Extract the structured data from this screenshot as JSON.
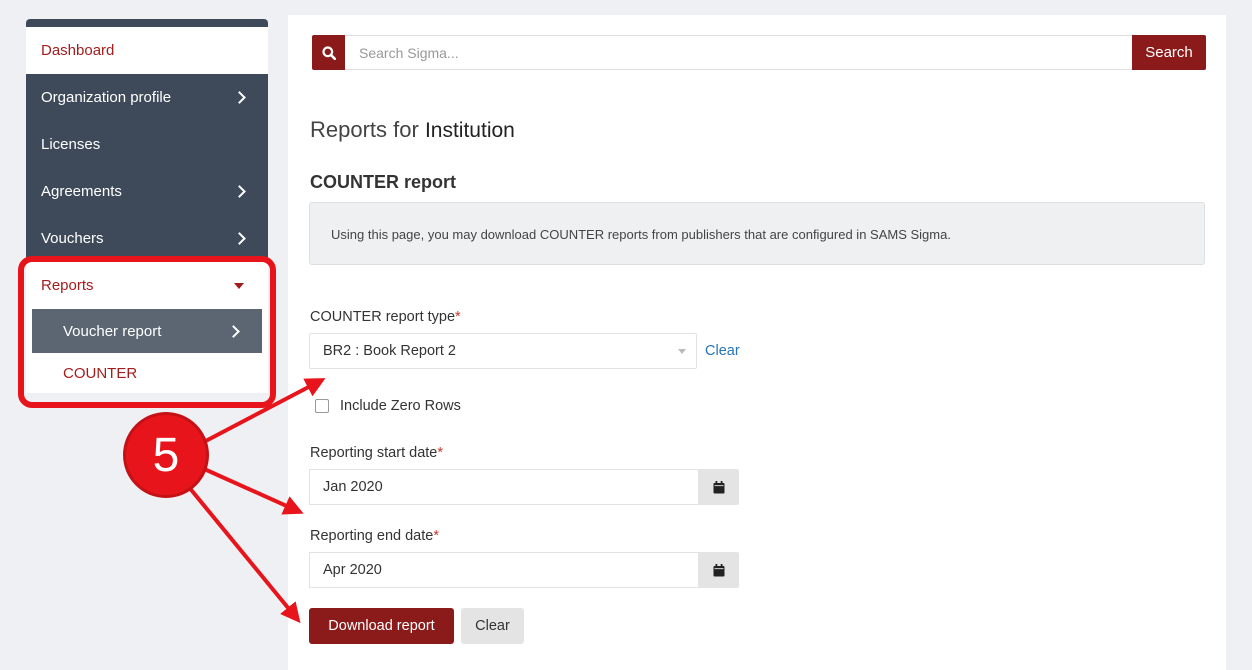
{
  "sidebar": {
    "items": [
      {
        "label": "Dashboard"
      },
      {
        "label": "Organization profile"
      },
      {
        "label": "Licenses"
      },
      {
        "label": "Agreements"
      },
      {
        "label": "Vouchers"
      },
      {
        "label": "Reports"
      },
      {
        "label": "Voucher report"
      },
      {
        "label": "COUNTER"
      }
    ]
  },
  "search": {
    "placeholder": "Search Sigma...",
    "button_label": "Search"
  },
  "main": {
    "title_prefix": "Reports for",
    "title_entity": "Institution",
    "section_title": "COUNTER report",
    "info_text": "Using this page, you may download COUNTER reports from publishers that are configured in SAMS Sigma.",
    "report_type_label": "COUNTER report type",
    "report_type_value": "BR2 : Book Report 2",
    "clear_link": "Clear",
    "include_zero_rows": "Include Zero Rows",
    "start_date_label": "Reporting start date",
    "start_date_value": "Jan 2020",
    "end_date_label": "Reporting end date",
    "end_date_value": "Apr 2020",
    "download_button": "Download report",
    "clear_button": "Clear",
    "required_mark": "*"
  },
  "annotation": {
    "step_number": "5"
  },
  "colors": {
    "brand": "#8b1a1a",
    "sidebar_dark": "#3e4a5a",
    "annotation_red": "#e8141b",
    "link": "#2774b6"
  }
}
